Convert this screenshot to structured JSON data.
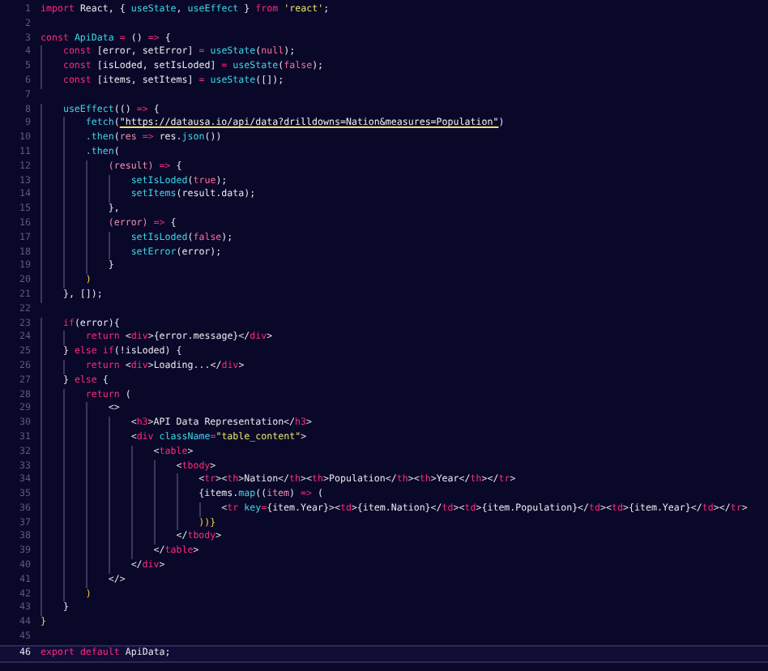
{
  "editor": {
    "lines": [
      {
        "number": "1",
        "current": false,
        "tokens": [
          {
            "kind": "kw",
            "text": "import"
          },
          {
            "kind": "txt",
            "text": " React, { "
          },
          {
            "kind": "fn",
            "text": "useState"
          },
          {
            "kind": "txt",
            "text": ", "
          },
          {
            "kind": "fn",
            "text": "useEffect"
          },
          {
            "kind": "txt",
            "text": " } "
          },
          {
            "kind": "kw",
            "text": "from"
          },
          {
            "kind": "str",
            "text": " 'react'"
          },
          {
            "kind": "txt",
            "text": ";"
          }
        ]
      },
      {
        "number": "2",
        "current": false
      },
      {
        "number": "3",
        "current": false,
        "tokens": [
          {
            "kind": "kw",
            "text": "const"
          },
          {
            "kind": "fn",
            "text": " ApiData"
          },
          {
            "kind": "kw",
            "text": " = "
          },
          {
            "kind": "txt",
            "text": "() "
          },
          {
            "kind": "kw",
            "text": "=>"
          },
          {
            "kind": "txt",
            "text": " {"
          }
        ]
      },
      {
        "number": "4",
        "current": false,
        "tokens": [
          {
            "kind": "kw",
            "text": "    const"
          },
          {
            "kind": "txt",
            "text": " [error, setError] "
          },
          {
            "kind": "kw",
            "text": "="
          },
          {
            "kind": "fn",
            "text": " useState"
          },
          {
            "kind": "txt",
            "text": "("
          },
          {
            "kind": "lit",
            "text": "null"
          },
          {
            "kind": "txt",
            "text": ");"
          }
        ]
      },
      {
        "number": "5",
        "current": false,
        "tokens": [
          {
            "kind": "kw",
            "text": "    const"
          },
          {
            "kind": "txt",
            "text": " [isLoded, setIsLoded] "
          },
          {
            "kind": "kw",
            "text": "="
          },
          {
            "kind": "fn",
            "text": " useState"
          },
          {
            "kind": "txt",
            "text": "("
          },
          {
            "kind": "lit",
            "text": "false"
          },
          {
            "kind": "txt",
            "text": ");"
          }
        ]
      },
      {
        "number": "6",
        "current": false,
        "tokens": [
          {
            "kind": "kw",
            "text": "    const"
          },
          {
            "kind": "txt",
            "text": " [items, setItems] "
          },
          {
            "kind": "kw",
            "text": "="
          },
          {
            "kind": "fn",
            "text": " useState"
          },
          {
            "kind": "txt",
            "text": "([]);"
          }
        ]
      },
      {
        "number": "7",
        "current": false
      },
      {
        "number": "8",
        "current": false,
        "tokens": [
          {
            "kind": "fn",
            "text": "    useEffect"
          },
          {
            "kind": "txt",
            "text": "(() "
          },
          {
            "kind": "kw",
            "text": "=>"
          },
          {
            "kind": "txt",
            "text": " {"
          }
        ]
      },
      {
        "number": "9",
        "current": false,
        "tokens": [
          {
            "kind": "fn",
            "text": "        fetch"
          },
          {
            "kind": "txt",
            "text": "("
          },
          {
            "kind": "url",
            "text": "\"https://datausa.io/api/data?drilldowns=Nation&measures=Population\""
          },
          {
            "kind": "txt",
            "text": ")"
          }
        ]
      },
      {
        "number": "10",
        "current": false,
        "tokens": [
          {
            "kind": "fn",
            "text": "        .then"
          },
          {
            "kind": "txt",
            "text": "("
          },
          {
            "kind": "par",
            "text": "res"
          },
          {
            "kind": "kw",
            "text": " => "
          },
          {
            "kind": "txt",
            "text": "res."
          },
          {
            "kind": "fn",
            "text": "json"
          },
          {
            "kind": "txt",
            "text": "())"
          }
        ]
      },
      {
        "number": "11",
        "current": false,
        "tokens": [
          {
            "kind": "fn",
            "text": "        .then"
          },
          {
            "kind": "txt",
            "text": "("
          }
        ]
      },
      {
        "number": "12",
        "current": false,
        "tokens": [
          {
            "kind": "par",
            "text": "            (result) "
          },
          {
            "kind": "kw",
            "text": "=>"
          },
          {
            "kind": "txt",
            "text": " {"
          }
        ]
      },
      {
        "number": "13",
        "current": false,
        "tokens": [
          {
            "kind": "fn",
            "text": "                setIsLoded"
          },
          {
            "kind": "txt",
            "text": "("
          },
          {
            "kind": "lit",
            "text": "true"
          },
          {
            "kind": "txt",
            "text": ");"
          }
        ]
      },
      {
        "number": "14",
        "current": false,
        "tokens": [
          {
            "kind": "fn",
            "text": "                setItems"
          },
          {
            "kind": "txt",
            "text": "(result.data);"
          }
        ]
      },
      {
        "number": "15",
        "current": false,
        "tokens": [
          {
            "kind": "txt",
            "text": "            },"
          }
        ]
      },
      {
        "number": "16",
        "current": false,
        "tokens": [
          {
            "kind": "par",
            "text": "            (error) "
          },
          {
            "kind": "kw",
            "text": "=>"
          },
          {
            "kind": "txt",
            "text": " {"
          }
        ]
      },
      {
        "number": "17",
        "current": false,
        "tokens": [
          {
            "kind": "fn",
            "text": "                setIsLoded"
          },
          {
            "kind": "txt",
            "text": "("
          },
          {
            "kind": "lit",
            "text": "false"
          },
          {
            "kind": "txt",
            "text": ");"
          }
        ]
      },
      {
        "number": "18",
        "current": false,
        "tokens": [
          {
            "kind": "fn",
            "text": "                setError"
          },
          {
            "kind": "txt",
            "text": "(error);"
          }
        ]
      },
      {
        "number": "19",
        "current": false,
        "tokens": [
          {
            "kind": "txt",
            "text": "            }"
          }
        ]
      },
      {
        "number": "20",
        "current": false,
        "tokens": [
          {
            "kind": "br",
            "text": "        )"
          }
        ]
      },
      {
        "number": "21",
        "current": false,
        "tokens": [
          {
            "kind": "txt",
            "text": "    }, []);"
          }
        ]
      },
      {
        "number": "22",
        "current": false
      },
      {
        "number": "23",
        "current": false,
        "tokens": [
          {
            "kind": "kw",
            "text": "    if"
          },
          {
            "kind": "txt",
            "text": "(error){"
          }
        ]
      },
      {
        "number": "24",
        "current": false,
        "tokens": [
          {
            "kind": "kw",
            "text": "        return"
          },
          {
            "kind": "txt",
            "text": " <"
          },
          {
            "kind": "tag",
            "text": "div"
          },
          {
            "kind": "txt",
            "text": ">{error.message}</"
          },
          {
            "kind": "tag",
            "text": "div"
          },
          {
            "kind": "txt",
            "text": ">"
          }
        ]
      },
      {
        "number": "25",
        "current": false,
        "tokens": [
          {
            "kind": "txt",
            "text": "    } "
          },
          {
            "kind": "kw",
            "text": "else if"
          },
          {
            "kind": "txt",
            "text": "(!isLoded) {"
          }
        ]
      },
      {
        "number": "26",
        "current": false,
        "tokens": [
          {
            "kind": "kw",
            "text": "        return"
          },
          {
            "kind": "txt",
            "text": " <"
          },
          {
            "kind": "tag",
            "text": "div"
          },
          {
            "kind": "txt",
            "text": ">Loading...</"
          },
          {
            "kind": "tag",
            "text": "div"
          },
          {
            "kind": "txt",
            "text": ">"
          }
        ]
      },
      {
        "number": "27",
        "current": false,
        "tokens": [
          {
            "kind": "txt",
            "text": "    } "
          },
          {
            "kind": "kw",
            "text": "else"
          },
          {
            "kind": "txt",
            "text": " {"
          }
        ]
      },
      {
        "number": "28",
        "current": false,
        "tokens": [
          {
            "kind": "kw",
            "text": "        return"
          },
          {
            "kind": "txt",
            "text": " ("
          }
        ]
      },
      {
        "number": "29",
        "current": false,
        "tokens": [
          {
            "kind": "txt",
            "text": "            <>"
          }
        ]
      },
      {
        "number": "30",
        "current": false,
        "tokens": [
          {
            "kind": "txt",
            "text": "                <"
          },
          {
            "kind": "tag",
            "text": "h3"
          },
          {
            "kind": "txt",
            "text": ">API Data Representation</"
          },
          {
            "kind": "tag",
            "text": "h3"
          },
          {
            "kind": "txt",
            "text": ">"
          }
        ]
      },
      {
        "number": "31",
        "current": false,
        "tokens": [
          {
            "kind": "txt",
            "text": "                <"
          },
          {
            "kind": "tag",
            "text": "div"
          },
          {
            "kind": "attr",
            "text": " className"
          },
          {
            "kind": "kw",
            "text": "="
          },
          {
            "kind": "str",
            "text": "\"table_content\""
          },
          {
            "kind": "txt",
            "text": ">"
          }
        ]
      },
      {
        "number": "32",
        "current": false,
        "tokens": [
          {
            "kind": "txt",
            "text": "                    <"
          },
          {
            "kind": "tag",
            "text": "table"
          },
          {
            "kind": "txt",
            "text": ">"
          }
        ]
      },
      {
        "number": "33",
        "current": false,
        "tokens": [
          {
            "kind": "txt",
            "text": "                        <"
          },
          {
            "kind": "tag",
            "text": "tbody"
          },
          {
            "kind": "txt",
            "text": ">"
          }
        ]
      },
      {
        "number": "34",
        "current": false,
        "tokens": [
          {
            "kind": "txt",
            "text": "                            <"
          },
          {
            "kind": "tag",
            "text": "tr"
          },
          {
            "kind": "txt",
            "text": "><"
          },
          {
            "kind": "tag",
            "text": "th"
          },
          {
            "kind": "txt",
            "text": ">Nation</"
          },
          {
            "kind": "tag",
            "text": "th"
          },
          {
            "kind": "txt",
            "text": "><"
          },
          {
            "kind": "tag",
            "text": "th"
          },
          {
            "kind": "txt",
            "text": ">Population</"
          },
          {
            "kind": "tag",
            "text": "th"
          },
          {
            "kind": "txt",
            "text": "><"
          },
          {
            "kind": "tag",
            "text": "th"
          },
          {
            "kind": "txt",
            "text": ">Year</"
          },
          {
            "kind": "tag",
            "text": "th"
          },
          {
            "kind": "txt",
            "text": "></"
          },
          {
            "kind": "tag",
            "text": "tr"
          },
          {
            "kind": "txt",
            "text": ">"
          }
        ]
      },
      {
        "number": "35",
        "current": false,
        "tokens": [
          {
            "kind": "txt",
            "text": "                            {items."
          },
          {
            "kind": "fn",
            "text": "map"
          },
          {
            "kind": "txt",
            "text": "(("
          },
          {
            "kind": "par",
            "text": "item"
          },
          {
            "kind": "txt",
            "text": ") "
          },
          {
            "kind": "kw",
            "text": "=>"
          },
          {
            "kind": "txt",
            "text": " ("
          }
        ]
      },
      {
        "number": "36",
        "current": false,
        "tokens": [
          {
            "kind": "txt",
            "text": "                                <"
          },
          {
            "kind": "tag",
            "text": "tr"
          },
          {
            "kind": "attr",
            "text": " key"
          },
          {
            "kind": "kw",
            "text": "="
          },
          {
            "kind": "txt",
            "text": "{item.Year}><"
          },
          {
            "kind": "tag",
            "text": "td"
          },
          {
            "kind": "txt",
            "text": ">{item.Nation}</"
          },
          {
            "kind": "tag",
            "text": "td"
          },
          {
            "kind": "txt",
            "text": "><"
          },
          {
            "kind": "tag",
            "text": "td"
          },
          {
            "kind": "txt",
            "text": ">{item.Population}</"
          },
          {
            "kind": "tag",
            "text": "td"
          },
          {
            "kind": "txt",
            "text": "><"
          },
          {
            "kind": "tag",
            "text": "td"
          },
          {
            "kind": "txt",
            "text": ">{item.Year}</"
          },
          {
            "kind": "tag",
            "text": "td"
          },
          {
            "kind": "txt",
            "text": "></"
          },
          {
            "kind": "tag",
            "text": "tr"
          },
          {
            "kind": "txt",
            "text": ">"
          }
        ]
      },
      {
        "number": "37",
        "current": false,
        "tokens": [
          {
            "kind": "br",
            "text": "                            ))}"
          }
        ]
      },
      {
        "number": "38",
        "current": false,
        "tokens": [
          {
            "kind": "txt",
            "text": "                        </"
          },
          {
            "kind": "tag",
            "text": "tbody"
          },
          {
            "kind": "txt",
            "text": ">"
          }
        ]
      },
      {
        "number": "39",
        "current": false,
        "tokens": [
          {
            "kind": "txt",
            "text": "                    </"
          },
          {
            "kind": "tag",
            "text": "table"
          },
          {
            "kind": "txt",
            "text": ">"
          }
        ]
      },
      {
        "number": "40",
        "current": false,
        "tokens": [
          {
            "kind": "txt",
            "text": "                </"
          },
          {
            "kind": "tag",
            "text": "div"
          },
          {
            "kind": "txt",
            "text": ">"
          }
        ]
      },
      {
        "number": "41",
        "current": false,
        "tokens": [
          {
            "kind": "txt",
            "text": "            </>"
          }
        ]
      },
      {
        "number": "42",
        "current": false,
        "tokens": [
          {
            "kind": "br",
            "text": "        )"
          }
        ]
      },
      {
        "number": "43",
        "current": false,
        "tokens": [
          {
            "kind": "txt",
            "text": "    }"
          }
        ]
      },
      {
        "number": "44",
        "current": false,
        "tokens": [
          {
            "kind": "br",
            "text": "}"
          }
        ]
      },
      {
        "number": "45",
        "current": false
      },
      {
        "number": "46",
        "current": true,
        "tokens": [
          {
            "kind": "kw",
            "text": "export"
          },
          {
            "kind": "kw",
            "text": " default"
          },
          {
            "kind": "txt",
            "text": " ApiData;"
          }
        ]
      }
    ]
  }
}
